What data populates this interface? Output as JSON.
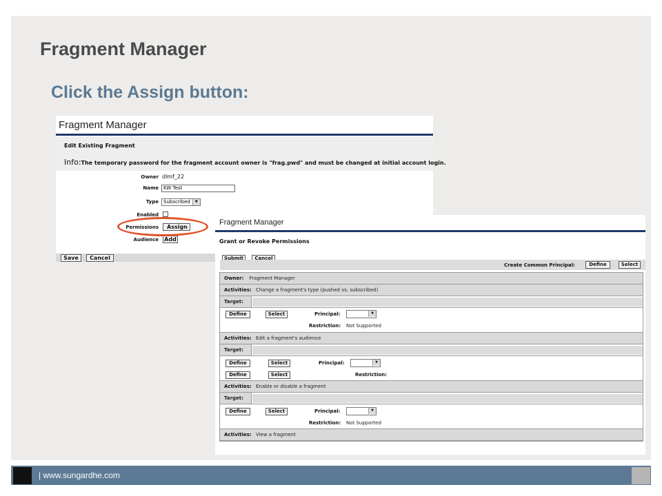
{
  "slide": {
    "title": "Fragment Manager",
    "subtitle": "Click the Assign button:",
    "footer_text": "| www.sungardhe.com"
  },
  "shot1": {
    "header": "Fragment Manager",
    "section_title": "Edit Existing Fragment",
    "info_label": "Info:",
    "info_text": "The temporary password for the fragment account owner is \"frag.pwd\" and must be changed at initial account login.",
    "fields": {
      "owner_label": "Owner",
      "owner_value": "dlmf_22",
      "name_label": "Name",
      "name_value": "KW Test",
      "type_label": "Type",
      "type_value": "Subscribed",
      "enabled_label": "Enabled",
      "permissions_label": "Permissions",
      "audience_label": "Audience"
    },
    "buttons": {
      "assign": "Assign",
      "add": "Add",
      "save": "Save",
      "cancel": "Cancel"
    }
  },
  "shot2": {
    "header": "Fragment Manager",
    "section_title": "Grant or Revoke Permissions",
    "buttons": {
      "submit": "Submit",
      "cancel": "Cancel",
      "define": "Define",
      "select": "Select"
    },
    "common_principal_label": "Create Common Principal:",
    "owner_label": "Owner:",
    "owner_value": "Fragment Manager",
    "activities_label": "Activities:",
    "target_label": "Target:",
    "principal_label": "Principal:",
    "restriction_label": "Restriction:",
    "not_supported": "Not Supported",
    "activities": [
      "Change a fragment's type (pushed vs. subscribed)",
      "Edit a fragment's audience",
      "Enable or disable a fragment",
      "View a fragment"
    ]
  },
  "colors": {
    "title": "#4a4a4a",
    "subtitle": "#5b7a93",
    "highlight_ellipse": "#e0542b",
    "footer_bar": "#5c7a94"
  }
}
